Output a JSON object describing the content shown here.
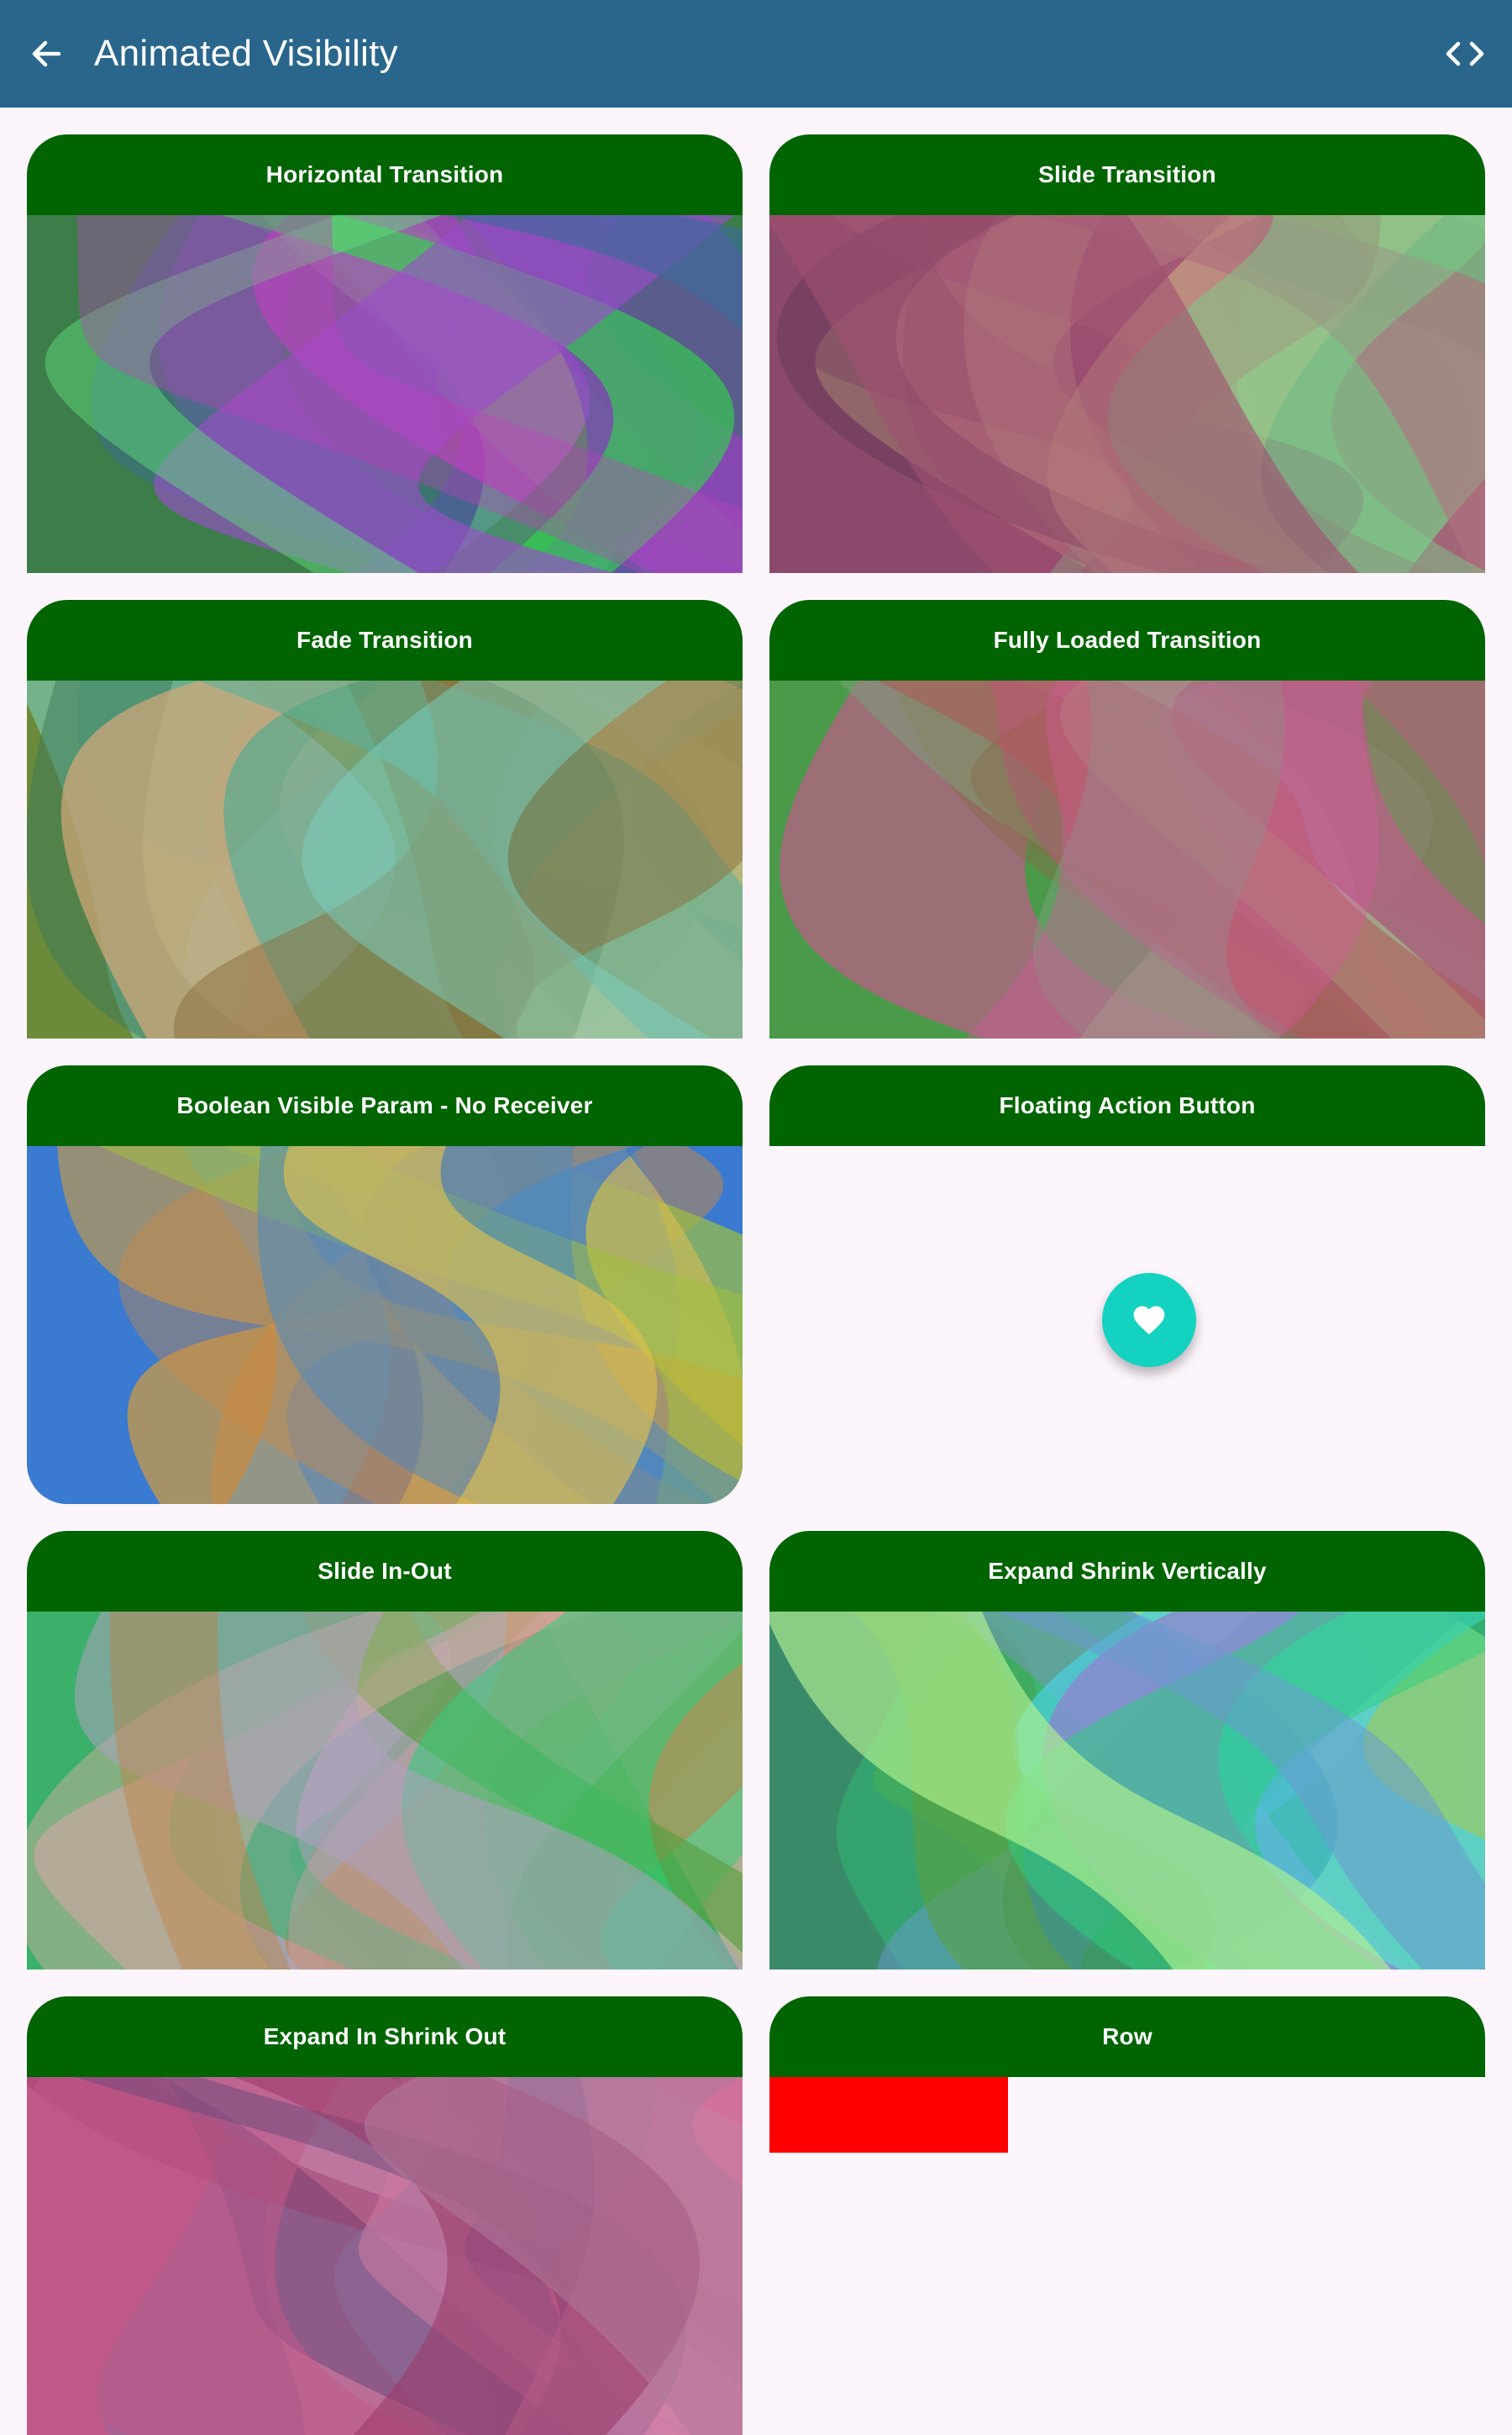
{
  "appbar": {
    "title": "Animated Visibility",
    "back_icon": "arrow-back-icon",
    "code_icon": "code-icon"
  },
  "cards": [
    {
      "title": "Horizontal Transition",
      "palette": [
        "#3c7d4a",
        "#7b3bd0",
        "#2fd94a",
        "#9a4fc8",
        "#3b6b9b",
        "#5fe37a",
        "#c040c0"
      ]
    },
    {
      "title": "Slide Transition",
      "palette": [
        "#8b4a6b",
        "#c8b88a",
        "#6b3a5a",
        "#d9c08a",
        "#b07080",
        "#7ad18a",
        "#a05070"
      ]
    },
    {
      "title": "Fade Transition",
      "palette": [
        "#6b8a3a",
        "#c8c08a",
        "#3a7a5a",
        "#d9a87a",
        "#5ab09a",
        "#8a6a3a",
        "#7ad0c0"
      ]
    },
    {
      "title": "Fully Loaded Transition",
      "palette": [
        "#4a9a4a",
        "#c05a8a",
        "#8a6a4a",
        "#a0d090",
        "#b05a5a",
        "#7aa07a",
        "#d05a9a"
      ]
    },
    {
      "title": "Boolean Visible Param - No Receiver",
      "palette": [
        "#3a7ad0",
        "#e0a030",
        "#5aa0d0",
        "#d08a40",
        "#a0c040",
        "#4a8ac0",
        "#e0c050"
      ]
    },
    {
      "title": "Floating Action Button",
      "fab_icon": "heart-icon"
    },
    {
      "title": "Slide In-Out",
      "palette": [
        "#3ab06a",
        "#d0a0b0",
        "#5aa040",
        "#e0b0a0",
        "#2ad07a",
        "#b0a0c0",
        "#c08040"
      ]
    },
    {
      "title": "Expand Shrink Vertically",
      "palette": [
        "#3a8a6a",
        "#4ad0e0",
        "#5aa040",
        "#9a7ad0",
        "#2ad07a",
        "#6a9ad0",
        "#b0f090"
      ]
    },
    {
      "title": "Expand In Shrink Out",
      "palette": [
        "#c05a8a",
        "#8a6a9a",
        "#d07aa0",
        "#6a4a7a",
        "#e08ab0",
        "#9a3a6a",
        "#b07a9a"
      ]
    },
    {
      "title": "Row"
    }
  ],
  "colors": {
    "appbar": "#2a668b",
    "card_header": "#006400",
    "fab": "#13d2c0",
    "row_box": "#ff0000"
  }
}
